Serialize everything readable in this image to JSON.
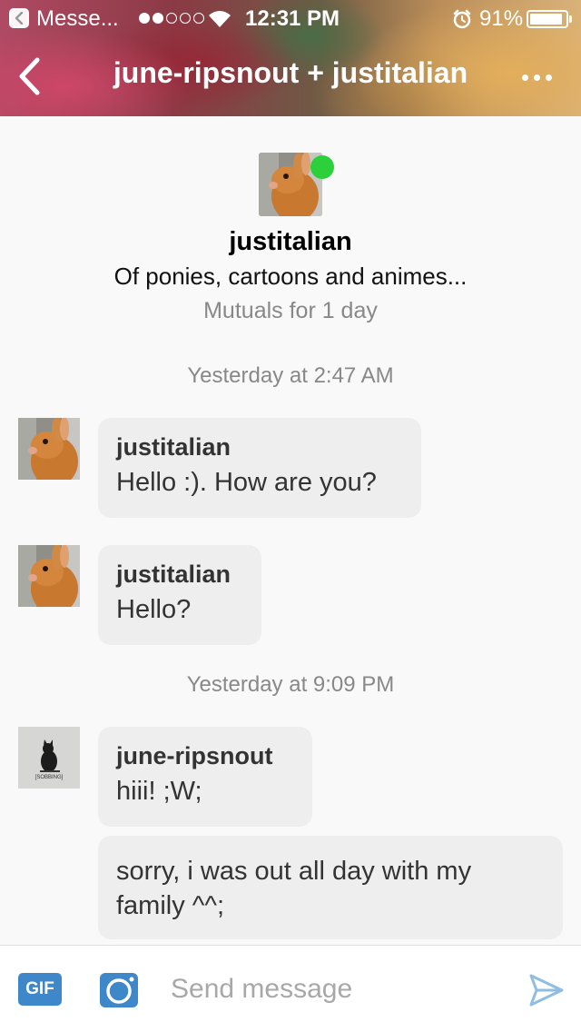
{
  "status_bar": {
    "back_app": "Messe...",
    "time": "12:31 PM",
    "battery": "91%",
    "battery_level": 0.91,
    "signal_bars": 2,
    "signal_total": 5
  },
  "nav": {
    "title": "june-ripsnout + justitalian"
  },
  "profile": {
    "name": "justitalian",
    "description": "Of ponies, cartoons and animes...",
    "mutuals": "Mutuals for 1 day",
    "online": true
  },
  "timestamps": {
    "first": "Yesterday at 2:47 AM",
    "second": "Yesterday at 9:09 PM"
  },
  "messages": [
    {
      "sender": "justitalian",
      "text": "Hello :). How are you?"
    },
    {
      "sender": "justitalian",
      "text": "Hello?"
    },
    {
      "sender": "june-ripsnout",
      "text": "hiii! ;W;"
    },
    {
      "sender": "",
      "text": "sorry, i was out all day with my family ^^;"
    }
  ],
  "avatar_captions": {
    "june": "[SOBBING]"
  },
  "composer": {
    "gif_label": "GIF",
    "placeholder": "Send message"
  },
  "colors": {
    "online": "#2bd03b",
    "accent": "#3e87c9",
    "bubble": "#eeeeee",
    "muted_text": "#888888"
  },
  "icons": {
    "back": "chevron-left-icon",
    "more": "more-horizontal-icon",
    "camera": "camera-icon",
    "send": "send-icon"
  }
}
